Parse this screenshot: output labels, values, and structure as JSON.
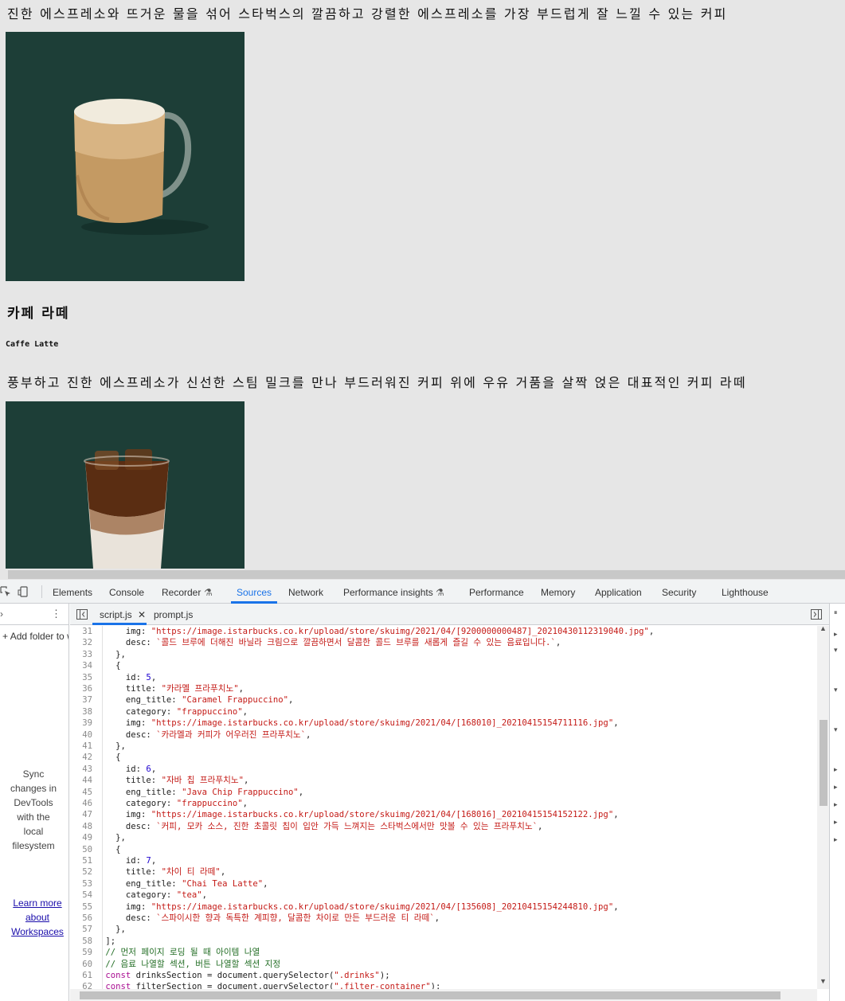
{
  "page": {
    "desc_americano": "진한 에스프레소와 뜨거운 물을 섞어 스타벅스의 깔끔하고 강렬한 에스프레소를 가장 부드럽게 잘 느낄 수 있는 커피",
    "latte_title": "카페 라떼",
    "latte_eng_title": "Caffe Latte",
    "latte_desc": "풍부하고 진한 에스프레소가 신선한 스팀 밀크를 만나 부드러워진 커피 위에 우유 거품을 살짝 얹은 대표적인 커피 라떼"
  },
  "devtools": {
    "tabs": [
      "Elements",
      "Console",
      "Recorder",
      "Sources",
      "Network",
      "Performance insights",
      "Performance",
      "Memory",
      "Application",
      "Security",
      "Lighthouse"
    ],
    "active_tab": "Sources",
    "left_panel": {
      "add_folder": "Add folder to workspace",
      "sync_text": "Sync changes in DevTools with the local filesystem",
      "learn_link": "Learn more about Workspaces"
    },
    "editor_tabs": [
      "script.js",
      "prompt.js"
    ],
    "active_file": "script.js",
    "code_lines": [
      {
        "n": "31",
        "t": "    img: \"https://image.istarbucks.co.kr/upload/store/skuimg/2021/04/[9200000000487]_20210430112319040.jpg\","
      },
      {
        "n": "32",
        "t": "    desc: `콜드 브루에 더해진 바닐라 크림으로 깔끔하면서 달콤한 콜드 브루를 새롭게 즐길 수 있는 음료입니다.`,"
      },
      {
        "n": "33",
        "t": "  },"
      },
      {
        "n": "34",
        "t": "  {"
      },
      {
        "n": "35",
        "t": "    id: 5,"
      },
      {
        "n": "36",
        "t": "    title: \"카라멜 프라푸치노\","
      },
      {
        "n": "37",
        "t": "    eng_title: \"Caramel Frappuccino\","
      },
      {
        "n": "38",
        "t": "    category: \"frappuccino\","
      },
      {
        "n": "39",
        "t": "    img: \"https://image.istarbucks.co.kr/upload/store/skuimg/2021/04/[168010]_20210415154711116.jpg\","
      },
      {
        "n": "40",
        "t": "    desc: `카라멜과 커피가 어우러진 프라푸치노`,"
      },
      {
        "n": "41",
        "t": "  },"
      },
      {
        "n": "42",
        "t": "  {"
      },
      {
        "n": "43",
        "t": "    id: 6,"
      },
      {
        "n": "44",
        "t": "    title: \"자바 칩 프라푸치노\","
      },
      {
        "n": "45",
        "t": "    eng_title: \"Java Chip Frappuccino\","
      },
      {
        "n": "46",
        "t": "    category: \"frappuccino\","
      },
      {
        "n": "47",
        "t": "    img: \"https://image.istarbucks.co.kr/upload/store/skuimg/2021/04/[168016]_20210415154152122.jpg\","
      },
      {
        "n": "48",
        "t": "    desc: `커피, 모카 소스, 진한 초콜릿 칩이 입안 가득 느껴지는 스타벅스에서만 맛볼 수 있는 프라푸치노`,"
      },
      {
        "n": "49",
        "t": "  },"
      },
      {
        "n": "50",
        "t": "  {"
      },
      {
        "n": "51",
        "t": "    id: 7,"
      },
      {
        "n": "52",
        "t": "    title: \"차이 티 라떼\","
      },
      {
        "n": "53",
        "t": "    eng_title: \"Chai Tea Latte\","
      },
      {
        "n": "54",
        "t": "    category: \"tea\","
      },
      {
        "n": "55",
        "t": "    img: \"https://image.istarbucks.co.kr/upload/store/skuimg/2021/04/[135608]_20210415154244810.jpg\","
      },
      {
        "n": "56",
        "t": "    desc: `스파이시한 향과 독특한 계피향, 달콤한 차이로 만든 부드러운 티 라떼`,"
      },
      {
        "n": "57",
        "t": "  },"
      },
      {
        "n": "58",
        "t": "];"
      },
      {
        "n": "59",
        "t": "// 먼저 페이지 로딩 될 때 아이템 나열"
      },
      {
        "n": "60",
        "t": "// 음료 나열할 섹션, 버튼 나열할 섹션 지정"
      },
      {
        "n": "61",
        "t": "const drinksSection = document.querySelector(\".drinks\");"
      },
      {
        "n": "62",
        "t": "const filterSection = document.querySelector(\".filter-container\");"
      }
    ]
  }
}
